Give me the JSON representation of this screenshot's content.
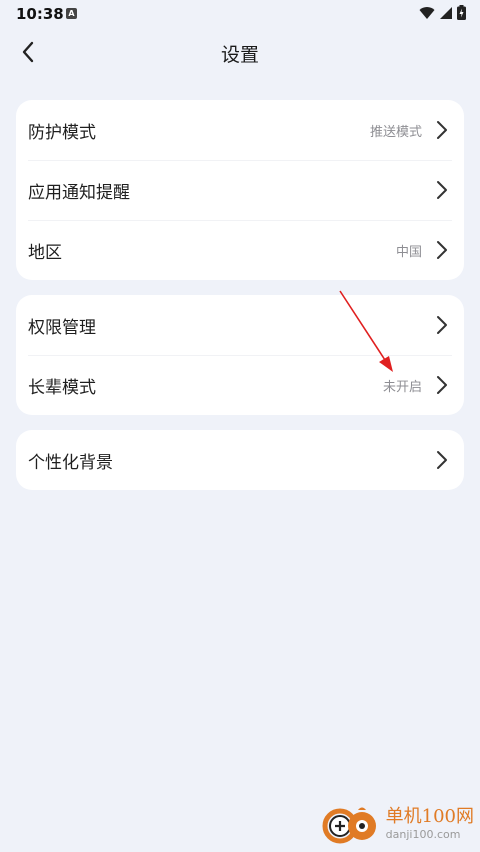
{
  "status_bar": {
    "time": "10:38",
    "notification_icon": "a-notification-icon",
    "icons": [
      "wifi-icon",
      "signal-icon",
      "battery-charging-icon"
    ]
  },
  "header": {
    "back_icon": "chevron-left-icon",
    "title": "设置"
  },
  "groups": [
    {
      "items": [
        {
          "label": "防护模式",
          "value": "推送模式"
        },
        {
          "label": "应用通知提醒",
          "value": ""
        },
        {
          "label": "地区",
          "value": "中国"
        }
      ]
    },
    {
      "items": [
        {
          "label": "权限管理",
          "value": ""
        },
        {
          "label": "长辈模式",
          "value": "未开启"
        }
      ]
    },
    {
      "items": [
        {
          "label": "个性化背景",
          "value": ""
        }
      ]
    }
  ],
  "annotation": {
    "type": "red-arrow",
    "target": "长辈模式"
  },
  "watermark": {
    "text_cn": "单机100网",
    "text_en": "danji100.com"
  },
  "colors": {
    "background": "#eff2f9",
    "card": "#ffffff",
    "accent_arrow": "#e02020",
    "watermark_orange": "#e07b25"
  }
}
